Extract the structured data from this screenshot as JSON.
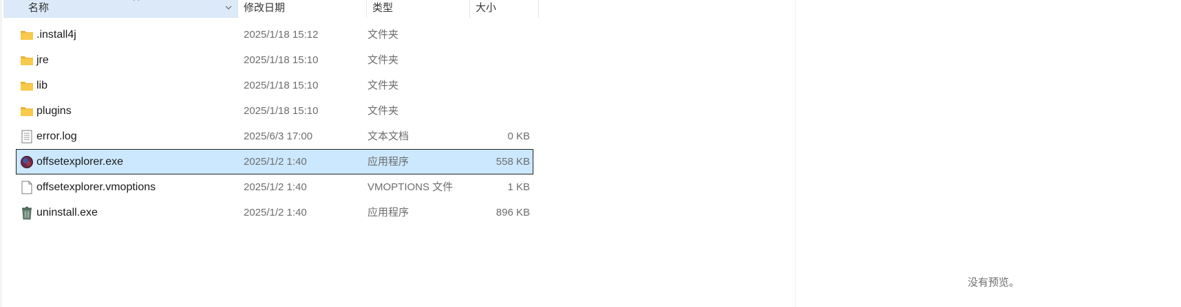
{
  "header": {
    "name_label": "名称",
    "date_label": "修改日期",
    "type_label": "类型",
    "size_label": "大小"
  },
  "files": [
    {
      "icon": "folder-icon",
      "name": ".install4j",
      "date": "2025/1/18 15:12",
      "type": "文件夹",
      "size": ""
    },
    {
      "icon": "folder-icon",
      "name": "jre",
      "date": "2025/1/18 15:10",
      "type": "文件夹",
      "size": ""
    },
    {
      "icon": "folder-icon",
      "name": "lib",
      "date": "2025/1/18 15:10",
      "type": "文件夹",
      "size": ""
    },
    {
      "icon": "folder-icon",
      "name": "plugins",
      "date": "2025/1/18 15:10",
      "type": "文件夹",
      "size": ""
    },
    {
      "icon": "text-document-icon",
      "name": "error.log",
      "date": "2025/6/3 17:00",
      "type": "文本文档",
      "size": "0 KB"
    },
    {
      "icon": "offsetexplorer-app-icon",
      "name": "offsetexplorer.exe",
      "date": "2025/1/2 1:40",
      "type": "应用程序",
      "size": "558 KB",
      "selected": true
    },
    {
      "icon": "blank-file-icon",
      "name": "offsetexplorer.vmoptions",
      "date": "2025/1/2 1:40",
      "type": "VMOPTIONS 文件",
      "size": "1 KB"
    },
    {
      "icon": "uninstall-app-icon",
      "name": "uninstall.exe",
      "date": "2025/1/2 1:40",
      "type": "应用程序",
      "size": "896 KB"
    }
  ],
  "preview": {
    "empty_text": "没有预览。"
  },
  "colors": {
    "selected_bg": "#cce8ff",
    "header_sorted_bg": "#dbe9f8",
    "folder_yellow": "#f8c94a"
  }
}
